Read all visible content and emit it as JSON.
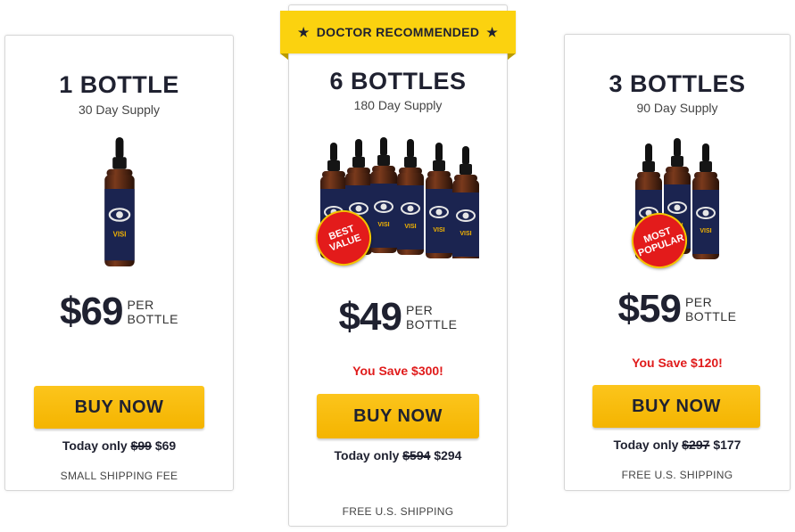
{
  "ribbon": {
    "label": "DOCTOR RECOMMENDED",
    "star": "★"
  },
  "colors": {
    "accent_yellow": "#f4b400",
    "save_red": "#e01b1b",
    "badge_red": "#e31b1b",
    "bottle_navy": "#1b2450"
  },
  "products": {
    "one": {
      "title": "1 BOTTLE",
      "supply": "30 Day Supply",
      "price": "$69",
      "per1": "PER",
      "per2": "BOTTLE",
      "buy": "BUY NOW",
      "today_prefix": "Today only",
      "old_price": "$99",
      "new_price": "$69",
      "shipping": "SMALL SHIPPING FEE",
      "brand": "VISIPRIME"
    },
    "six": {
      "title": "6 BOTTLES",
      "supply": "180 Day Supply",
      "price": "$49",
      "per1": "PER",
      "per2": "BOTTLE",
      "save": "You Save $300!",
      "buy": "BUY NOW",
      "today_prefix": "Today only",
      "old_price": "$594",
      "new_price": "$294",
      "shipping": "FREE U.S. SHIPPING",
      "badge1": "BEST",
      "badge2": "VALUE",
      "brand": "VISIPRIME"
    },
    "three": {
      "title": "3 BOTTLES",
      "supply": "90 Day Supply",
      "price": "$59",
      "per1": "PER",
      "per2": "BOTTLE",
      "save": "You Save $120!",
      "buy": "BUY NOW",
      "today_prefix": "Today only",
      "old_price": "$297",
      "new_price": "$177",
      "shipping": "FREE U.S. SHIPPING",
      "badge1": "MOST",
      "badge2": "POPULAR",
      "brand": "VISIPRIME"
    }
  }
}
